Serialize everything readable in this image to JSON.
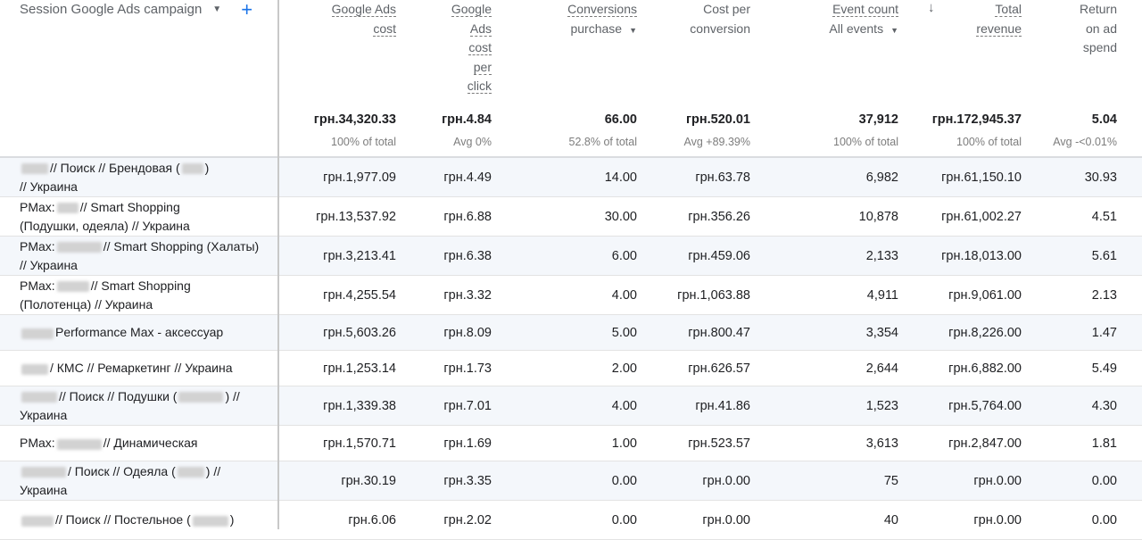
{
  "dimension": {
    "label": "Session Google Ads campaign"
  },
  "columns": [
    {
      "lines": [
        "Google Ads",
        "cost"
      ],
      "underline": true,
      "sub": "",
      "total": "грн.34,320.33",
      "total_sub": "100% of total"
    },
    {
      "lines": [
        "Google",
        "Ads",
        "cost",
        "per",
        "click"
      ],
      "underline": true,
      "sub": "",
      "total": "грн.4.84",
      "total_sub": "Avg 0%"
    },
    {
      "lines": [
        "Conversions"
      ],
      "underline": true,
      "sub": "purchase",
      "total": "66.00",
      "total_sub": "52.8% of total"
    },
    {
      "lines": [
        "Cost per",
        "conversion"
      ],
      "underline": false,
      "sub": "",
      "total": "грн.520.01",
      "total_sub": "Avg +89.39%"
    },
    {
      "lines": [
        "Event count"
      ],
      "underline": true,
      "sub": "All events",
      "total": "37,912",
      "total_sub": "100% of total"
    },
    {
      "lines": [
        "Total",
        "revenue"
      ],
      "underline": true,
      "sub": "",
      "total": "грн.172,945.37",
      "total_sub": "100% of total"
    },
    {
      "lines": [
        "Return",
        "on ad",
        "spend"
      ],
      "underline": false,
      "sub": "",
      "total": "5.04",
      "total_sub": "Avg -<0.01%"
    }
  ],
  "rows": [
    {
      "campaign": [
        [
          "[blur]",
          "// Поиск // Брендовая (",
          "[blur]",
          ")"
        ],
        [
          "// Украина"
        ]
      ],
      "values": [
        "грн.1,977.09",
        "грн.4.49",
        "14.00",
        "грн.63.78",
        "6,982",
        "грн.61,150.10",
        "30.93"
      ]
    },
    {
      "campaign": [
        [
          "PMax:",
          "[blur]",
          "// Smart Shopping"
        ],
        [
          "(Подушки, одеяла) // Украина"
        ]
      ],
      "values": [
        "грн.13,537.92",
        "грн.6.88",
        "30.00",
        "грн.356.26",
        "10,878",
        "грн.61,002.27",
        "4.51"
      ]
    },
    {
      "campaign": [
        [
          "PMax:",
          "[blur]",
          "// Smart Shopping (Халаты)"
        ],
        [
          "// Украина"
        ]
      ],
      "values": [
        "грн.3,213.41",
        "грн.6.38",
        "6.00",
        "грн.459.06",
        "2,133",
        "грн.18,013.00",
        "5.61"
      ]
    },
    {
      "campaign": [
        [
          "PMax:",
          "[blur]",
          "// Smart Shopping"
        ],
        [
          "(Полотенца) // Украина"
        ]
      ],
      "values": [
        "грн.4,255.54",
        "грн.3.32",
        "4.00",
        "грн.1,063.88",
        "4,911",
        "грн.9,061.00",
        "2.13"
      ]
    },
    {
      "campaign": [
        [
          "[blur]",
          "Performance Max - аксессуар"
        ]
      ],
      "values": [
        "грн.5,603.26",
        "грн.8.09",
        "5.00",
        "грн.800.47",
        "3,354",
        "грн.8,226.00",
        "1.47"
      ]
    },
    {
      "campaign": [
        [
          "[blur]",
          "/ КМС // Ремаркетинг // Украина"
        ]
      ],
      "values": [
        "грн.1,253.14",
        "грн.1.73",
        "2.00",
        "грн.626.57",
        "2,644",
        "грн.6,882.00",
        "5.49"
      ]
    },
    {
      "campaign": [
        [
          "[blur]",
          "// Поиск // Подушки (",
          "[blur]",
          ") //"
        ],
        [
          "Украина"
        ]
      ],
      "values": [
        "грн.1,339.38",
        "грн.7.01",
        "4.00",
        "грн.41.86",
        "1,523",
        "грн.5,764.00",
        "4.30"
      ]
    },
    {
      "campaign": [
        [
          "PMax:",
          "[blur]",
          "// Динамическая"
        ]
      ],
      "values": [
        "грн.1,570.71",
        "грн.1.69",
        "1.00",
        "грн.523.57",
        "3,613",
        "грн.2,847.00",
        "1.81"
      ]
    },
    {
      "campaign": [
        [
          "[blur]",
          "/ Поиск // Одеяла (",
          "[blur]",
          ") //"
        ],
        [
          "Украина"
        ]
      ],
      "values": [
        "грн.30.19",
        "грн.3.35",
        "0.00",
        "грн.0.00",
        "75",
        "грн.0.00",
        "0.00"
      ]
    },
    {
      "campaign": [
        [
          "[blur]",
          "// Поиск // Постельное (",
          "[blur]",
          ")"
        ]
      ],
      "values": [
        "грн.6.06",
        "грн.2.02",
        "0.00",
        "грн.0.00",
        "40",
        "грн.0.00",
        "0.00"
      ]
    }
  ],
  "colors": {
    "accent": "#1a73e8",
    "alt_row": "#f4f7fb"
  }
}
